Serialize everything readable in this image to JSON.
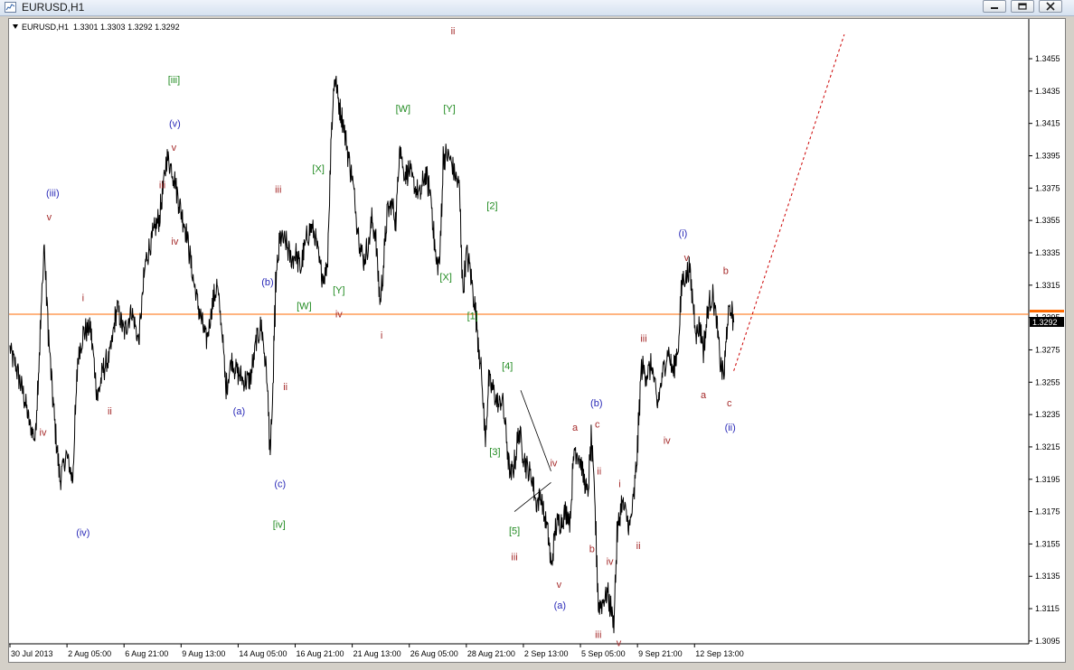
{
  "window": {
    "title": "EURUSD,H1",
    "buttons": [
      "minimize",
      "restore",
      "close"
    ]
  },
  "chart_info": "EURUSD,H1  1.3301 1.3303 1.3292 1.3292",
  "colors": {
    "price": "#000000",
    "level_line": "#ff6a00",
    "projection": "#cc0000",
    "wave_red": "#a52a2a",
    "wave_green": "#228b22",
    "wave_blue": "#2a2ab8"
  },
  "chart_data": {
    "type": "line",
    "symbol": "EURUSD",
    "timeframe": "H1",
    "ohlc": {
      "open": 1.3301,
      "high": 1.3303,
      "low": 1.3292,
      "close": 1.3292
    },
    "current_price_label": "1.3292",
    "horizontal_line_price": 1.3297,
    "ylim": [
      1.3086,
      1.3474
    ],
    "y_ticks": [
      "1.3455",
      "1.3435",
      "1.3415",
      "1.3395",
      "1.3375",
      "1.3355",
      "1.3335",
      "1.3315",
      "1.3295",
      "1.3275",
      "1.3255",
      "1.3235",
      "1.3215",
      "1.3195",
      "1.3175",
      "1.3155",
      "1.3135",
      "1.3115",
      "1.3095"
    ],
    "x_ticks": [
      "30 Jul 2013",
      "2 Aug 05:00",
      "6 Aug 21:00",
      "9 Aug 13:00",
      "14 Aug 05:00",
      "16 Aug 21:00",
      "21 Aug 13:00",
      "26 Aug 05:00",
      "28 Aug 21:00",
      "2 Sep 13:00",
      "5 Sep 05:00",
      "9 Sep 21:00",
      "12 Sep 13:00"
    ],
    "x_tick_index": [
      0,
      64,
      128,
      192,
      256,
      320,
      384,
      448,
      512,
      576,
      640,
      704,
      768
    ],
    "price_path": [
      [
        0,
        1.3275
      ],
      [
        8,
        1.3262
      ],
      [
        16,
        1.3245
      ],
      [
        22,
        1.3228
      ],
      [
        28,
        1.322
      ],
      [
        33,
        1.3275
      ],
      [
        38,
        1.334
      ],
      [
        44,
        1.3275
      ],
      [
        50,
        1.323
      ],
      [
        56,
        1.3195
      ],
      [
        63,
        1.321
      ],
      [
        70,
        1.3195
      ],
      [
        76,
        1.327
      ],
      [
        82,
        1.3285
      ],
      [
        90,
        1.329
      ],
      [
        98,
        1.3245
      ],
      [
        104,
        1.3262
      ],
      [
        112,
        1.3272
      ],
      [
        120,
        1.3302
      ],
      [
        128,
        1.3285
      ],
      [
        136,
        1.33
      ],
      [
        144,
        1.328
      ],
      [
        152,
        1.333
      ],
      [
        160,
        1.3345
      ],
      [
        168,
        1.3358
      ],
      [
        176,
        1.3395
      ],
      [
        184,
        1.3382
      ],
      [
        190,
        1.3365
      ],
      [
        196,
        1.3352
      ],
      [
        200,
        1.334
      ],
      [
        205,
        1.332
      ],
      [
        210,
        1.3305
      ],
      [
        216,
        1.329
      ],
      [
        220,
        1.328
      ],
      [
        226,
        1.33
      ],
      [
        232,
        1.3315
      ],
      [
        238,
        1.3285
      ],
      [
        242,
        1.325
      ],
      [
        248,
        1.3268
      ],
      [
        255,
        1.3262
      ],
      [
        262,
        1.3255
      ],
      [
        270,
        1.3258
      ],
      [
        276,
        1.328
      ],
      [
        282,
        1.329
      ],
      [
        288,
        1.3258
      ],
      [
        292,
        1.321
      ],
      [
        295,
        1.3255
      ],
      [
        298,
        1.3315
      ],
      [
        303,
        1.3345
      ],
      [
        310,
        1.334
      ],
      [
        316,
        1.333
      ],
      [
        320,
        1.3335
      ],
      [
        326,
        1.3325
      ],
      [
        333,
        1.3345
      ],
      [
        338,
        1.335
      ],
      [
        342,
        1.3345
      ],
      [
        348,
        1.3325
      ],
      [
        352,
        1.332
      ],
      [
        356,
        1.333
      ],
      [
        360,
        1.3405
      ],
      [
        364,
        1.3445
      ],
      [
        368,
        1.343
      ],
      [
        373,
        1.3418
      ],
      [
        378,
        1.34
      ],
      [
        384,
        1.338
      ],
      [
        390,
        1.335
      ],
      [
        396,
        1.333
      ],
      [
        402,
        1.334
      ],
      [
        406,
        1.3355
      ],
      [
        410,
        1.3345
      ],
      [
        415,
        1.3305
      ],
      [
        418,
        1.332
      ],
      [
        423,
        1.336
      ],
      [
        428,
        1.3365
      ],
      [
        433,
        1.3355
      ],
      [
        437,
        1.3405
      ],
      [
        441,
        1.3385
      ],
      [
        448,
        1.3385
      ],
      [
        454,
        1.3375
      ],
      [
        460,
        1.337
      ],
      [
        466,
        1.3385
      ],
      [
        472,
        1.337
      ],
      [
        478,
        1.3328
      ],
      [
        482,
        1.333
      ],
      [
        486,
        1.3395
      ],
      [
        492,
        1.3395
      ],
      [
        498,
        1.3385
      ],
      [
        504,
        1.3375
      ],
      [
        508,
        1.331
      ],
      [
        512,
        1.3335
      ],
      [
        516,
        1.3325
      ],
      [
        522,
        1.33
      ],
      [
        528,
        1.3265
      ],
      [
        533,
        1.322
      ],
      [
        537,
        1.3255
      ],
      [
        542,
        1.325
      ],
      [
        548,
        1.324
      ],
      [
        552,
        1.3245
      ],
      [
        556,
        1.3225
      ],
      [
        561,
        1.3195
      ],
      [
        566,
        1.3205
      ],
      [
        571,
        1.3225
      ],
      [
        576,
        1.321
      ],
      [
        581,
        1.32
      ],
      [
        586,
        1.3195
      ],
      [
        590,
        1.318
      ],
      [
        595,
        1.3185
      ],
      [
        600,
        1.317
      ],
      [
        604,
        1.316
      ],
      [
        607,
        1.314
      ],
      [
        612,
        1.3165
      ],
      [
        618,
        1.317
      ],
      [
        624,
        1.3175
      ],
      [
        628,
        1.317
      ],
      [
        633,
        1.3215
      ],
      [
        638,
        1.321
      ],
      [
        644,
        1.3195
      ],
      [
        648,
        1.3185
      ],
      [
        652,
        1.322
      ],
      [
        656,
        1.318
      ],
      [
        660,
        1.3115
      ],
      [
        665,
        1.312
      ],
      [
        670,
        1.3125
      ],
      [
        674,
        1.3115
      ],
      [
        677,
        1.3105
      ],
      [
        681,
        1.316
      ],
      [
        686,
        1.318
      ],
      [
        690,
        1.3175
      ],
      [
        695,
        1.3165
      ],
      [
        700,
        1.3185
      ],
      [
        704,
        1.3215
      ],
      [
        708,
        1.3265
      ],
      [
        714,
        1.326
      ],
      [
        720,
        1.3265
      ],
      [
        726,
        1.324
      ],
      [
        732,
        1.326
      ],
      [
        738,
        1.3275
      ],
      [
        744,
        1.326
      ],
      [
        750,
        1.328
      ],
      [
        754,
        1.332
      ],
      [
        758,
        1.332
      ],
      [
        762,
        1.3325
      ],
      [
        766,
        1.3305
      ],
      [
        770,
        1.3285
      ],
      [
        774,
        1.329
      ],
      [
        778,
        1.3275
      ],
      [
        783,
        1.33
      ],
      [
        788,
        1.331
      ],
      [
        793,
        1.329
      ],
      [
        797,
        1.3265
      ],
      [
        801,
        1.326
      ],
      [
        805,
        1.3295
      ],
      [
        809,
        1.33
      ],
      [
        812,
        1.3292
      ]
    ],
    "projection": [
      [
        812,
        1.3262
      ],
      [
        936,
        1.347
      ]
    ],
    "trendlines": [
      [
        [
          573,
          1.325
        ],
        [
          607,
          1.32
        ]
      ],
      [
        [
          566,
          1.3175
        ],
        [
          607,
          1.3193
        ]
      ]
    ],
    "wave_labels": [
      {
        "t": "(iii)",
        "x": 48,
        "p": 1.337,
        "c": "wave_blue"
      },
      {
        "t": "v",
        "x": 44,
        "p": 1.3355,
        "c": "wave_red"
      },
      {
        "t": "iv",
        "x": 37,
        "p": 1.3222,
        "c": "wave_red"
      },
      {
        "t": "(iv)",
        "x": 82,
        "p": 1.316,
        "c": "wave_blue"
      },
      {
        "t": "i",
        "x": 82,
        "p": 1.3305,
        "c": "wave_red"
      },
      {
        "t": "ii",
        "x": 112,
        "p": 1.3235,
        "c": "wave_red"
      },
      {
        "t": "[iii]",
        "x": 184,
        "p": 1.344,
        "c": "wave_green"
      },
      {
        "t": "(v)",
        "x": 185,
        "p": 1.3413,
        "c": "wave_blue"
      },
      {
        "t": "v",
        "x": 184,
        "p": 1.3398,
        "c": "wave_red"
      },
      {
        "t": "iii",
        "x": 171,
        "p": 1.3375,
        "c": "wave_red"
      },
      {
        "t": "iv",
        "x": 185,
        "p": 1.334,
        "c": "wave_red"
      },
      {
        "t": "(a)",
        "x": 257,
        "p": 1.3235,
        "c": "wave_blue"
      },
      {
        "t": "(b)",
        "x": 289,
        "p": 1.3315,
        "c": "wave_blue"
      },
      {
        "t": "iii",
        "x": 301,
        "p": 1.3372,
        "c": "wave_red"
      },
      {
        "t": "ii",
        "x": 309,
        "p": 1.325,
        "c": "wave_red"
      },
      {
        "t": "(c)",
        "x": 303,
        "p": 1.319,
        "c": "wave_blue"
      },
      {
        "t": "[iv]",
        "x": 302,
        "p": 1.3165,
        "c": "wave_green"
      },
      {
        "t": "[X]",
        "x": 346,
        "p": 1.3385,
        "c": "wave_green"
      },
      {
        "t": "[Y]",
        "x": 369,
        "p": 1.331,
        "c": "wave_green"
      },
      {
        "t": "[W]",
        "x": 330,
        "p": 1.33,
        "c": "wave_green"
      },
      {
        "t": "iv",
        "x": 369,
        "p": 1.3295,
        "c": "wave_red"
      },
      {
        "t": "ii",
        "x": 497,
        "p": 1.347,
        "c": "wave_red"
      },
      {
        "t": "[W]",
        "x": 441,
        "p": 1.3422,
        "c": "wave_green"
      },
      {
        "t": "[Y]",
        "x": 493,
        "p": 1.3422,
        "c": "wave_green"
      },
      {
        "t": "i",
        "x": 417,
        "p": 1.3282,
        "c": "wave_red"
      },
      {
        "t": "[X]",
        "x": 489,
        "p": 1.3318,
        "c": "wave_green"
      },
      {
        "t": "[2]",
        "x": 541,
        "p": 1.3362,
        "c": "wave_green"
      },
      {
        "t": "[1]",
        "x": 519,
        "p": 1.3294,
        "c": "wave_green"
      },
      {
        "t": "[4]",
        "x": 558,
        "p": 1.3263,
        "c": "wave_green"
      },
      {
        "t": "[3]",
        "x": 544,
        "p": 1.321,
        "c": "wave_green"
      },
      {
        "t": "iv",
        "x": 610,
        "p": 1.3203,
        "c": "wave_red"
      },
      {
        "t": "[5]",
        "x": 566,
        "p": 1.3161,
        "c": "wave_green"
      },
      {
        "t": "iii",
        "x": 566,
        "p": 1.3145,
        "c": "wave_red"
      },
      {
        "t": "v",
        "x": 616,
        "p": 1.3128,
        "c": "wave_red"
      },
      {
        "t": "(a)",
        "x": 617,
        "p": 1.3115,
        "c": "wave_blue"
      },
      {
        "t": "(b)",
        "x": 658,
        "p": 1.324,
        "c": "wave_blue"
      },
      {
        "t": "a",
        "x": 634,
        "p": 1.3225,
        "c": "wave_red"
      },
      {
        "t": "c",
        "x": 659,
        "p": 1.3227,
        "c": "wave_red"
      },
      {
        "t": "ii",
        "x": 661,
        "p": 1.3198,
        "c": "wave_red"
      },
      {
        "t": "i",
        "x": 684,
        "p": 1.319,
        "c": "wave_red"
      },
      {
        "t": "b",
        "x": 653,
        "p": 1.315,
        "c": "wave_red"
      },
      {
        "t": "iv",
        "x": 673,
        "p": 1.3142,
        "c": "wave_red"
      },
      {
        "t": "ii",
        "x": 705,
        "p": 1.3152,
        "c": "wave_red"
      },
      {
        "t": "iii",
        "x": 660,
        "p": 1.3097,
        "c": "wave_red"
      },
      {
        "t": "v",
        "x": 683,
        "p": 1.3092,
        "c": "wave_red"
      },
      {
        "t": "iii",
        "x": 711,
        "p": 1.328,
        "c": "wave_red"
      },
      {
        "t": "iv",
        "x": 737,
        "p": 1.3217,
        "c": "wave_red"
      },
      {
        "t": "(i)",
        "x": 755,
        "p": 1.3345,
        "c": "wave_blue"
      },
      {
        "t": "v",
        "x": 759,
        "p": 1.333,
        "c": "wave_red"
      },
      {
        "t": "b",
        "x": 803,
        "p": 1.3322,
        "c": "wave_red"
      },
      {
        "t": "a",
        "x": 778,
        "p": 1.3245,
        "c": "wave_red"
      },
      {
        "t": "c",
        "x": 807,
        "p": 1.324,
        "c": "wave_red"
      },
      {
        "t": "(ii)",
        "x": 808,
        "p": 1.3225,
        "c": "wave_blue"
      }
    ]
  }
}
